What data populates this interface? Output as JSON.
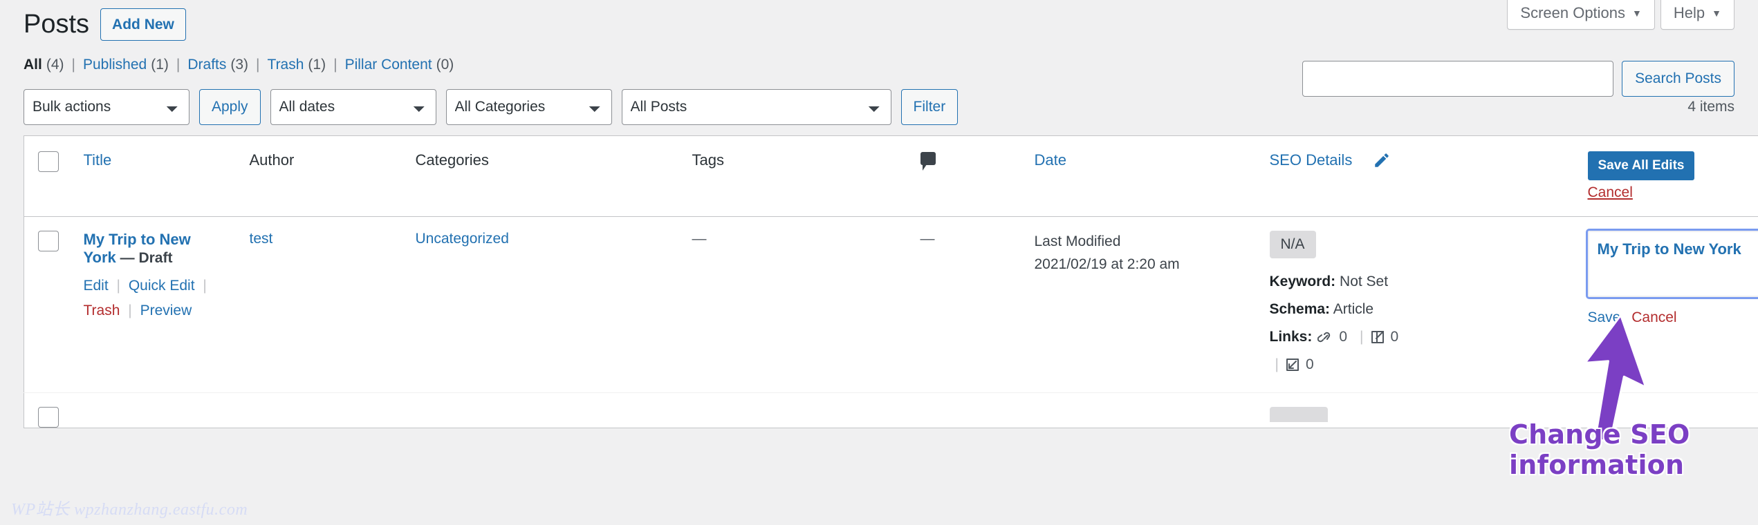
{
  "screen_meta": {
    "screen_options_label": "Screen Options",
    "help_label": "Help",
    "caret": "▼"
  },
  "header": {
    "page_title": "Posts",
    "add_new_label": "Add New"
  },
  "status_filters": [
    {
      "label": "All",
      "count": "(4)",
      "current": true
    },
    {
      "label": "Published",
      "count": "(1)",
      "current": false
    },
    {
      "label": "Drafts",
      "count": "(3)",
      "current": false
    },
    {
      "label": "Trash",
      "count": "(1)",
      "current": false
    },
    {
      "label": "Pillar Content",
      "count": "(0)",
      "current": false
    }
  ],
  "search": {
    "value": "",
    "placeholder": "",
    "submit_label": "Search Posts"
  },
  "tablenav": {
    "bulk_actions_selected": "Bulk actions",
    "apply_label": "Apply",
    "dates_selected": "All dates",
    "categories_selected": "All Categories",
    "posts_selected": "All Posts",
    "filter_label": "Filter",
    "displaying_num": "4 items"
  },
  "table_headers": {
    "title": "Title",
    "author": "Author",
    "categories": "Categories",
    "tags": "Tags",
    "comments_icon": "comment-bubble-icon",
    "date": "Date",
    "seo_details": "SEO Details",
    "edit_pencil_icon": "pencil-icon",
    "save_all_edits": "Save All Edits",
    "cancel": "Cancel"
  },
  "rows": [
    {
      "title": "My Trip to New York",
      "post_state": "— Draft",
      "actions": {
        "edit": "Edit",
        "quick_edit": "Quick Edit",
        "trash": "Trash",
        "preview": "Preview"
      },
      "author": "test",
      "categories": "Uncategorized",
      "tags": "—",
      "comments": "—",
      "date_label": "Last Modified",
      "date_value": "2021/02/19 at 2:20 am",
      "seo": {
        "score_badge": "N/A",
        "keyword_label": "Keyword:",
        "keyword_value": "Not Set",
        "schema_label": "Schema:",
        "schema_value": "Article",
        "links_label": "Links:",
        "internal_links_icon": "link-chain-icon",
        "internal_links_count": "0",
        "external_links_icon": "external-link-icon",
        "external_links_count": "0",
        "inbound_links_icon": "inbound-link-icon",
        "inbound_links_count": "0"
      },
      "seo_edit": {
        "value": "My Trip to New York",
        "save_label": "Save",
        "cancel_label": "Cancel"
      }
    }
  ],
  "annotation": {
    "arrow_icon": "purple-up-arrow-icon",
    "text_line1": "Change SEO",
    "text_line2": "information",
    "color": "#7b3fc4"
  },
  "watermark": {
    "text": "WP站长 wpzhanzhang.eastfu.com"
  },
  "colors": {
    "accent": "#2271b1",
    "danger": "#b32d2e",
    "page_bg": "#f0f0f1",
    "focus_ring": "#7a9bf0",
    "annotation": "#7b3fc4"
  }
}
